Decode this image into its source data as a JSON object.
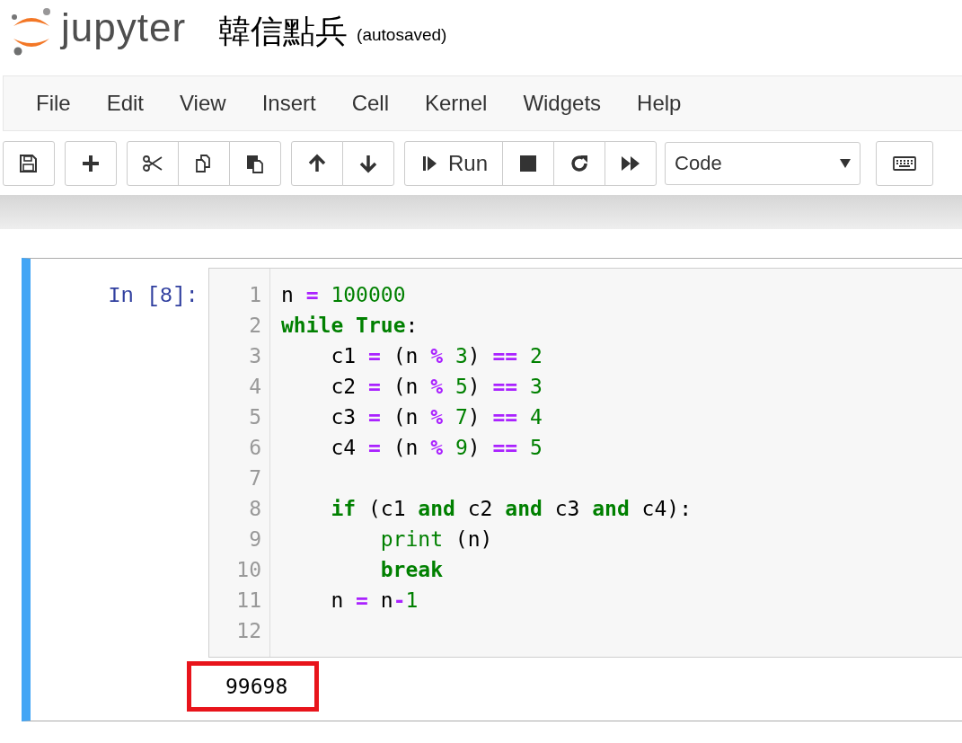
{
  "header": {
    "logo_text": "jupyter",
    "notebook_name": "韓信點兵",
    "save_status": "(autosaved)"
  },
  "menu": [
    "File",
    "Edit",
    "View",
    "Insert",
    "Cell",
    "Kernel",
    "Widgets",
    "Help"
  ],
  "toolbar": {
    "groups": [
      [
        {
          "kind": "save"
        }
      ],
      [
        {
          "kind": "add"
        }
      ],
      [
        {
          "kind": "cut"
        },
        {
          "kind": "copy"
        },
        {
          "kind": "paste"
        }
      ],
      [
        {
          "kind": "up"
        },
        {
          "kind": "down"
        }
      ],
      [
        {
          "kind": "run"
        },
        {
          "kind": "stop"
        },
        {
          "kind": "restart"
        },
        {
          "kind": "fast-forward"
        }
      ]
    ],
    "run_label": "Run",
    "cell_type": "Code"
  },
  "cell": {
    "prompt": "In [8]:",
    "selected": true,
    "lines": [
      {
        "number": "1",
        "tokens": [
          {
            "text": "n ",
            "kind": "name"
          },
          {
            "text": "=",
            "kind": "op"
          },
          {
            "text": " 100000",
            "kind": "num"
          }
        ]
      },
      {
        "number": "2",
        "tokens": [
          {
            "text": "while",
            "kind": "kw"
          },
          {
            "text": " True",
            "kind": "kw"
          },
          {
            "text": ":",
            "kind": "name"
          }
        ]
      },
      {
        "number": "3",
        "tokens": [
          {
            "text": "    c1 ",
            "kind": "name"
          },
          {
            "text": "=",
            "kind": "op"
          },
          {
            "text": " (n ",
            "kind": "name"
          },
          {
            "text": "%",
            "kind": "op"
          },
          {
            "text": " 3",
            "kind": "num"
          },
          {
            "text": ") ",
            "kind": "name"
          },
          {
            "text": "==",
            "kind": "op"
          },
          {
            "text": " 2",
            "kind": "num"
          }
        ]
      },
      {
        "number": "4",
        "tokens": [
          {
            "text": "    c2 ",
            "kind": "name"
          },
          {
            "text": "=",
            "kind": "op"
          },
          {
            "text": " (n ",
            "kind": "name"
          },
          {
            "text": "%",
            "kind": "op"
          },
          {
            "text": " 5",
            "kind": "num"
          },
          {
            "text": ") ",
            "kind": "name"
          },
          {
            "text": "==",
            "kind": "op"
          },
          {
            "text": " 3",
            "kind": "num"
          }
        ]
      },
      {
        "number": "5",
        "tokens": [
          {
            "text": "    c3 ",
            "kind": "name"
          },
          {
            "text": "=",
            "kind": "op"
          },
          {
            "text": " (n ",
            "kind": "name"
          },
          {
            "text": "%",
            "kind": "op"
          },
          {
            "text": " 7",
            "kind": "num"
          },
          {
            "text": ") ",
            "kind": "name"
          },
          {
            "text": "==",
            "kind": "op"
          },
          {
            "text": " 4",
            "kind": "num"
          }
        ]
      },
      {
        "number": "6",
        "tokens": [
          {
            "text": "    c4 ",
            "kind": "name"
          },
          {
            "text": "=",
            "kind": "op"
          },
          {
            "text": " (n ",
            "kind": "name"
          },
          {
            "text": "%",
            "kind": "op"
          },
          {
            "text": " 9",
            "kind": "num"
          },
          {
            "text": ") ",
            "kind": "name"
          },
          {
            "text": "==",
            "kind": "op"
          },
          {
            "text": " 5",
            "kind": "num"
          }
        ]
      },
      {
        "number": "7"
      },
      {
        "number": "8",
        "tokens": [
          {
            "text": "    if",
            "kind": "kw"
          },
          {
            "text": " (c1 ",
            "kind": "name"
          },
          {
            "text": "and",
            "kind": "kw"
          },
          {
            "text": " c2 ",
            "kind": "name"
          },
          {
            "text": "and",
            "kind": "kw"
          },
          {
            "text": " c3 ",
            "kind": "name"
          },
          {
            "text": "and",
            "kind": "kw"
          },
          {
            "text": " c4):",
            "kind": "name"
          }
        ]
      },
      {
        "number": "9",
        "tokens": [
          {
            "text": "        print",
            "kind": "builtin"
          },
          {
            "text": " (n)",
            "kind": "name"
          }
        ]
      },
      {
        "number": "10",
        "tokens": [
          {
            "text": "        break",
            "kind": "kw"
          }
        ]
      },
      {
        "number": "11",
        "tokens": [
          {
            "text": "    n ",
            "kind": "name"
          },
          {
            "text": "=",
            "kind": "op"
          },
          {
            "text": " n",
            "kind": "name"
          },
          {
            "text": "-",
            "kind": "op"
          },
          {
            "text": "1",
            "kind": "num"
          }
        ]
      },
      {
        "number": "12"
      }
    ],
    "output": {
      "text": "99698",
      "highlighted": true
    }
  }
}
